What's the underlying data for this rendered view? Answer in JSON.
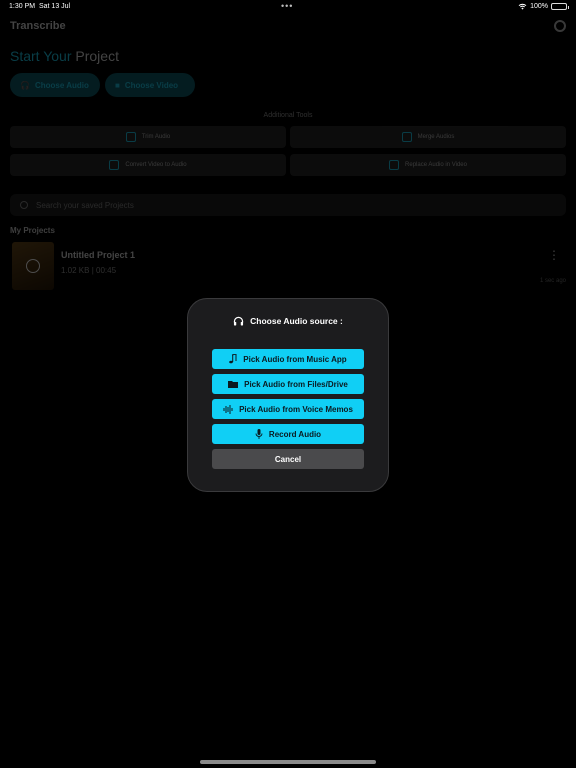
{
  "status": {
    "time": "1:30 PM",
    "date": "Sat 13 Jul",
    "dots": "•••",
    "battery": "100%"
  },
  "app": {
    "title": "Transcribe",
    "start_title_accent": "Start Your",
    "start_title_rest": "Project",
    "choose_audio": "Choose Audio",
    "choose_video": "Choose Video",
    "additional_tools": "Additional Tools",
    "tools": [
      {
        "label": "Trim Audio"
      },
      {
        "label": "Merge Audios"
      },
      {
        "label": "Convert Video to Audio"
      },
      {
        "label": "Replace Audio in Video"
      }
    ],
    "search_placeholder": "Search your saved Projects",
    "my_projects": "My Projects",
    "projects": [
      {
        "name": "Untitled Project 1",
        "size": "1.02 KB",
        "duration": "00:45",
        "date": "1 sec ago"
      }
    ]
  },
  "modal": {
    "title": "Choose Audio source :",
    "buttons": [
      {
        "label": "Pick Audio from Music App",
        "icon": "music-note-icon"
      },
      {
        "label": "Pick Audio from Files/Drive",
        "icon": "folder-icon"
      },
      {
        "label": "Pick Audio from Voice Memos",
        "icon": "waveform-icon"
      },
      {
        "label": "Record Audio",
        "icon": "microphone-icon"
      }
    ],
    "cancel": "Cancel"
  },
  "colors": {
    "accent": "#10cff5",
    "background": "#000000",
    "modal": "#1c1c1e"
  }
}
